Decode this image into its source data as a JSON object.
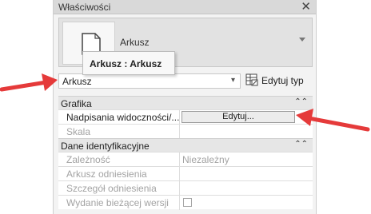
{
  "panel": {
    "title": "Właściwości",
    "close_icon": "close-icon",
    "type_name": "Arkusz",
    "tooltip": "Arkusz : Arkusz",
    "filter_value": "Arkusz",
    "edit_type_label": "Edytuj typ"
  },
  "groups": [
    {
      "title": "Grafika",
      "rows": [
        {
          "name": "Nadpisania widoczności/...",
          "value": "Edytuj...",
          "kind": "button",
          "disabled": false
        },
        {
          "name": "Skala",
          "value": "",
          "kind": "text",
          "disabled": true
        }
      ]
    },
    {
      "title": "Dane identyfikacyjne",
      "rows": [
        {
          "name": "Zależność",
          "value": "Niezależny",
          "kind": "text",
          "disabled": true
        },
        {
          "name": "Arkusz odniesienia",
          "value": "",
          "kind": "text",
          "disabled": true
        },
        {
          "name": "Szczegół odniesienia",
          "value": "",
          "kind": "text",
          "disabled": true
        },
        {
          "name": "Wydanie bieżącej wersji",
          "value": "",
          "kind": "checkbox",
          "disabled": true
        }
      ]
    }
  ],
  "colors": {
    "arrow": "#e53a3a",
    "panel_bg": "#f3f3f3",
    "section_bg": "#e6e6e6",
    "disabled_text": "#a3a3a3"
  }
}
